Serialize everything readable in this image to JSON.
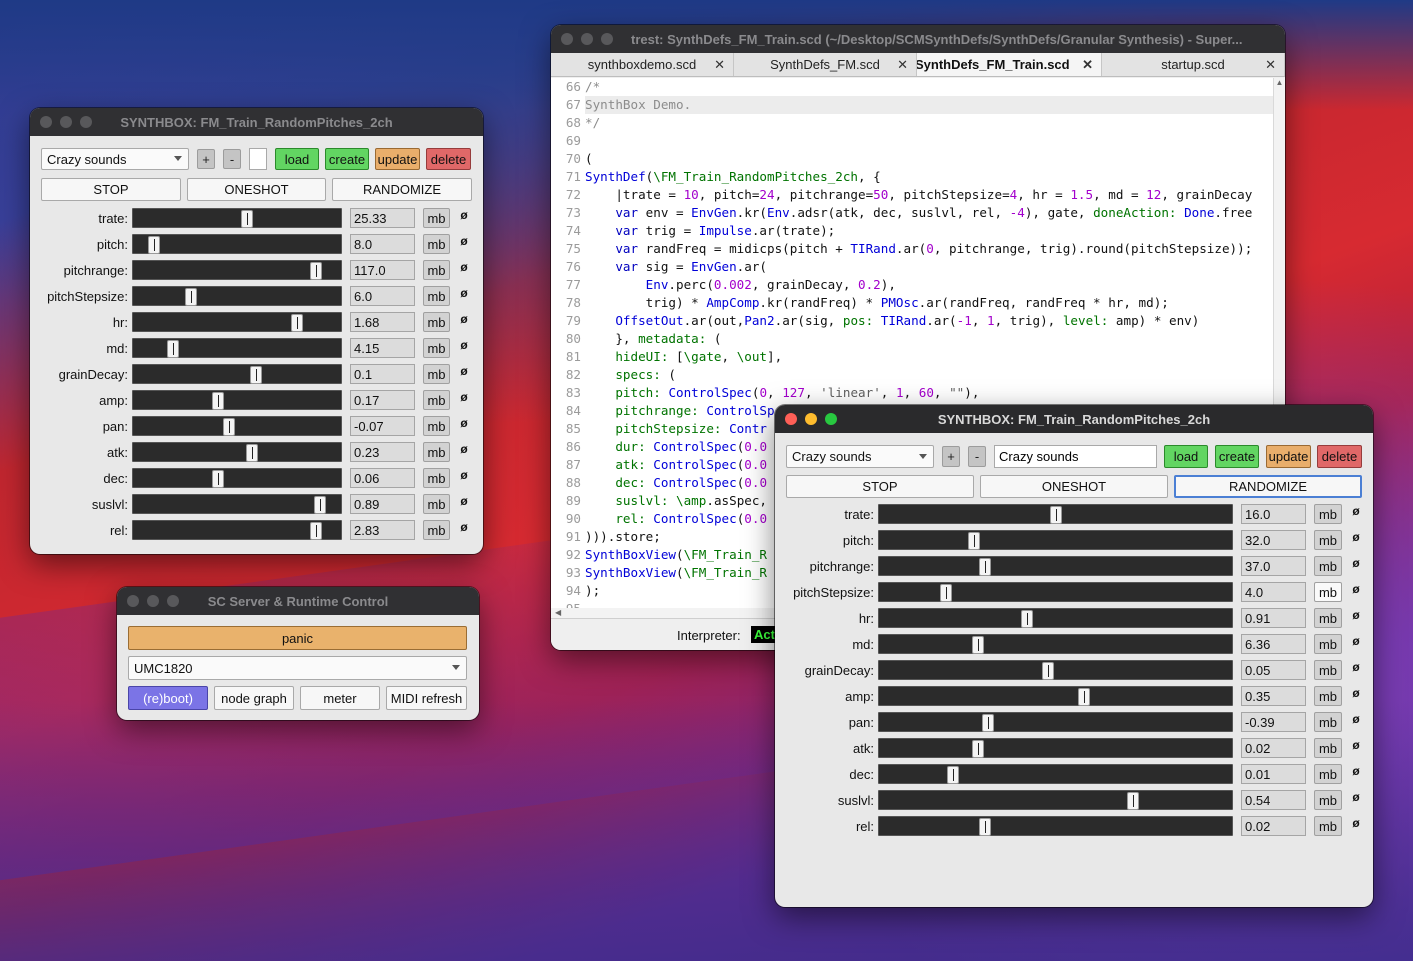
{
  "editor": {
    "title": "trest: SynthDefs_FM_Train.scd (~/Desktop/SCMSynthDefs/SynthDefs/Granular Synthesis) - Super...",
    "tabs": [
      {
        "label": "synthboxdemo.scd"
      },
      {
        "label": "SynthDefs_FM.scd"
      },
      {
        "label": "SynthDefs_FM_Train.scd"
      },
      {
        "label": "startup.scd"
      }
    ],
    "line_numbers": [
      "66",
      "67",
      "68",
      "69",
      "70",
      "71",
      "72",
      "73",
      "74",
      "75",
      "76",
      "77",
      "78",
      "79",
      "80",
      "81",
      "82",
      "83",
      "84",
      "85",
      "86",
      "87",
      "88",
      "89",
      "90",
      "91",
      "92",
      "93",
      "94",
      "95"
    ],
    "status_label": "Interpreter:",
    "status_value": "Act"
  },
  "synthbox_left": {
    "title": "SYNTHBOX: FM_Train_RandomPitches_2ch",
    "preset": "Crazy sounds",
    "preset_name": "",
    "plus": "+",
    "minus": "-",
    "load": "load",
    "create": "create",
    "update": "update",
    "delete": "delete",
    "stop": "STOP",
    "oneshot": "ONESHOT",
    "randomize": "RANDOMIZE",
    "params": [
      {
        "label": "trate:",
        "value": "25.33",
        "pos": 0.55
      },
      {
        "label": "pitch:",
        "value": "8.0",
        "pos": 0.1
      },
      {
        "label": "pitchrange:",
        "value": "117.0",
        "pos": 0.88
      },
      {
        "label": "pitchStepsize:",
        "value": "6.0",
        "pos": 0.28
      },
      {
        "label": "hr:",
        "value": "1.68",
        "pos": 0.79
      },
      {
        "label": "md:",
        "value": "4.15",
        "pos": 0.19
      },
      {
        "label": "grainDecay:",
        "value": "0.1",
        "pos": 0.59
      },
      {
        "label": "amp:",
        "value": "0.17",
        "pos": 0.41
      },
      {
        "label": "pan:",
        "value": "-0.07",
        "pos": 0.46
      },
      {
        "label": "atk:",
        "value": "0.23",
        "pos": 0.57
      },
      {
        "label": "dec:",
        "value": "0.06",
        "pos": 0.41
      },
      {
        "label": "suslvl:",
        "value": "0.89",
        "pos": 0.9
      },
      {
        "label": "rel:",
        "value": "2.83",
        "pos": 0.88
      }
    ],
    "mb": "mb",
    "phi": "ø"
  },
  "server": {
    "title": "SC Server & Runtime Control",
    "panic": "panic",
    "device": "UMC1820",
    "reboot": "(re)boot)",
    "node_graph": "node graph",
    "meter": "meter",
    "midi_refresh": "MIDI refresh"
  },
  "synthbox_right": {
    "title": "SYNTHBOX: FM_Train_RandomPitches_2ch",
    "preset": "Crazy sounds",
    "preset_name": "Crazy sounds",
    "plus": "+",
    "minus": "-",
    "load": "load",
    "create": "create",
    "update": "update",
    "delete": "delete",
    "stop": "STOP",
    "oneshot": "ONESHOT",
    "randomize": "RANDOMIZE",
    "params": [
      {
        "label": "trate:",
        "value": "16.0",
        "pos": 0.5
      },
      {
        "label": "pitch:",
        "value": "32.0",
        "pos": 0.27
      },
      {
        "label": "pitchrange:",
        "value": "37.0",
        "pos": 0.3
      },
      {
        "label": "pitchStepsize:",
        "value": "4.0",
        "pos": 0.19
      },
      {
        "label": "hr:",
        "value": "0.91",
        "pos": 0.42
      },
      {
        "label": "md:",
        "value": "6.36",
        "pos": 0.28
      },
      {
        "label": "grainDecay:",
        "value": "0.05",
        "pos": 0.48
      },
      {
        "label": "amp:",
        "value": "0.35",
        "pos": 0.58
      },
      {
        "label": "pan:",
        "value": "-0.39",
        "pos": 0.31
      },
      {
        "label": "atk:",
        "value": "0.02",
        "pos": 0.28
      },
      {
        "label": "dec:",
        "value": "0.01",
        "pos": 0.21
      },
      {
        "label": "suslvl:",
        "value": "0.54",
        "pos": 0.72
      },
      {
        "label": "rel:",
        "value": "0.02",
        "pos": 0.3
      }
    ],
    "mb": "mb",
    "phi": "ø"
  },
  "colors": {
    "green": "#62d562",
    "orange": "#e9ae6b",
    "red": "#e06868",
    "panic": "#e9b26c",
    "reboot": "#7b74e6"
  }
}
